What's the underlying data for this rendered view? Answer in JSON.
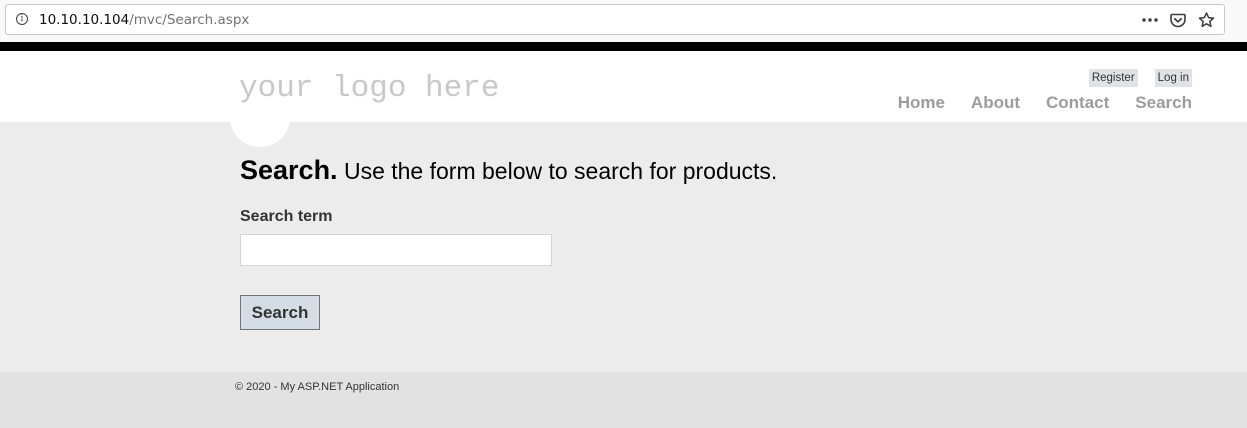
{
  "browser": {
    "url_host": "10.10.10.104",
    "url_path": "/mvc/Search.aspx",
    "info_icon_glyph": "i",
    "icons": [
      "info-icon",
      "page-actions-icon",
      "pocket-icon",
      "bookmark-star-icon"
    ]
  },
  "header": {
    "logo_text": "your logo here",
    "login_links": {
      "register": "Register",
      "login": "Log in"
    },
    "nav": {
      "home": "Home",
      "about": "About",
      "contact": "Contact",
      "search": "Search"
    }
  },
  "main": {
    "heading_strong": "Search.",
    "heading_sub": " Use the form below to search for products.",
    "search_label": "Search term",
    "search_value": "",
    "search_button": "Search"
  },
  "footer": {
    "text": "© 2020 - My ASP.NET Application"
  },
  "colors": {
    "header_bg": "#ffffff",
    "main_bg": "#ececec",
    "footer_bg": "#e2e2e2",
    "nav_text": "#9c9c9c",
    "button_bg": "#d3dde3"
  }
}
